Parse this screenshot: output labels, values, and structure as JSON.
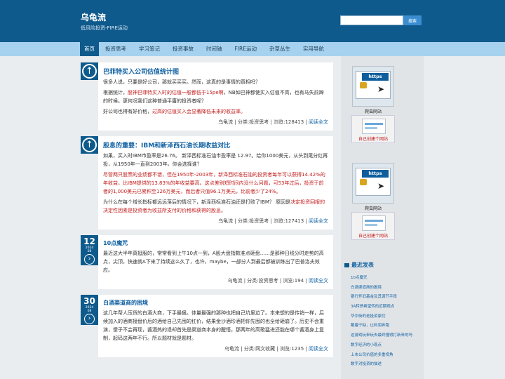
{
  "site": {
    "title": "乌龟流",
    "description": "低风险投资-FIRE运动"
  },
  "search": {
    "placeholder": "",
    "button_label": "搜索"
  },
  "nav": {
    "items": [
      "首页",
      "投资思考",
      "学习笔记",
      "投资事故",
      "时间轴",
      "FIRE运动",
      "杂草丛生",
      "实用导航"
    ],
    "active_index": 0
  },
  "posts": [
    {
      "badge": "arrow-up-icon",
      "title": "巴菲特买入公司估值统计图",
      "p1": "很多人说，只要是好公司，那就买买买。然而，这真的是事情的真相吗？",
      "p2a": "根据统计，",
      "p2b": "股神巴菲特买入时的估值一般都低于15pe啊",
      "p2c": "，NB如巴神都使买入估值不高，也有马失前蹄的时候。更何况我们这种普通平庸的投资者呢？",
      "p3a": "好公司也得有好价格，",
      "p3b": "过高的估值买入会显著降低未来的收益率。",
      "meta_author": "乌龟流",
      "meta_category": "分类:投资思考",
      "meta_views": "浏览:128413",
      "meta_read": "阅读全文"
    },
    {
      "badge": "arrow-up-icon",
      "title": "股息的重要：IBM和新泽西石油长期收益对比",
      "p1": "如果，买入时IBM市盈率是26.76。 新泽西标准石油市盈率是 12.97。给你1000美元，从头到尾分红再投，从1950年一直到2003年。你会选择谁？",
      "p2": "尽管两只股票的业绩都不错，但在1950年-2003年，新泽西标准石油的投资者每年可以获得14.42%的年收益，比IBM提供的13.83%的年收益要高。这点差别短时间内没什么问题，可53年过后，投资于前者的1,000美元已累积至126万美元，而后者只值96.1万美元，比前者少了24%。",
      "p3a": "为什么在每个增长指标都远远落后的情况下，新泽西标准石油还是打败了IBM？ 原因是",
      "p3b": "决定投资回报的决定性因素是投资者为收益所支付的价格和获得的股息。",
      "meta_author": "乌龟流",
      "meta_category": "分类:投资思考",
      "meta_views": "浏览:127413",
      "meta_read": "阅读全文"
    },
    {
      "badge_day": "12",
      "badge_year": "2024",
      "badge_month": "08",
      "title": "10点魔咒",
      "p1": "最近这大半年真挺服的，常常看到上午10点一到，A股大盘指数准点砸盘……是那种日线分时走势的高点，尖顶，快速就A下来了持续这么久了，也许，maybe，一部分人到最后都被训练出了巴普洛夫效应。",
      "meta_author": "乌龟流",
      "meta_category": "分类:投资思考",
      "meta_views": "浏览:194",
      "meta_read": "阅读全文"
    },
    {
      "badge_day": "30",
      "badge_year": "2024",
      "badge_month": "08",
      "title": "白酒渠道商的困境",
      "p1": "这几年帮人压货的白酒大商，下手最狠。体量最强的那种也把自己坑里边了。本来想的是传销一样，后续加入的酒商接盘价后的酒给自己先囤的扛价，结果金沙酒珍酒把你先囤的也全给砸崩了。历史不会重演，傻子不会再现，酱酒热的退却首先是渠道商本身的醒悟。那两年的高歌猛进还能在哪个酱酒身上复制，起码这两年不行。所以题材就是题材。",
      "meta_author": "乌龟流",
      "meta_category": "分类:网文收藏",
      "meta_views": "浏览:1235",
      "meta_read": "阅读全文"
    }
  ],
  "sidebar": {
    "ads": [
      {
        "banner": "https",
        "label": "爬虫网站",
        "caption": "自己创建个网站"
      },
      {
        "banner": "https",
        "label": "爬虫网站",
        "caption": "自己创建个网站"
      }
    ],
    "recent_title": "最近发表",
    "recent": [
      "10点魔咒",
      "白酒渠道商的困境",
      "银行怀旧基金及其调节手段",
      "3A转债希望转的近期观点",
      "华尔街的老投资家们",
      "戴着宁缺，让利润奔跑",
      "这游戏玩来玩去最终懂得打新来的吗",
      "数字经济的小观点",
      "上市公司价值的多重视角",
      "数字对投资的描述"
    ]
  }
}
